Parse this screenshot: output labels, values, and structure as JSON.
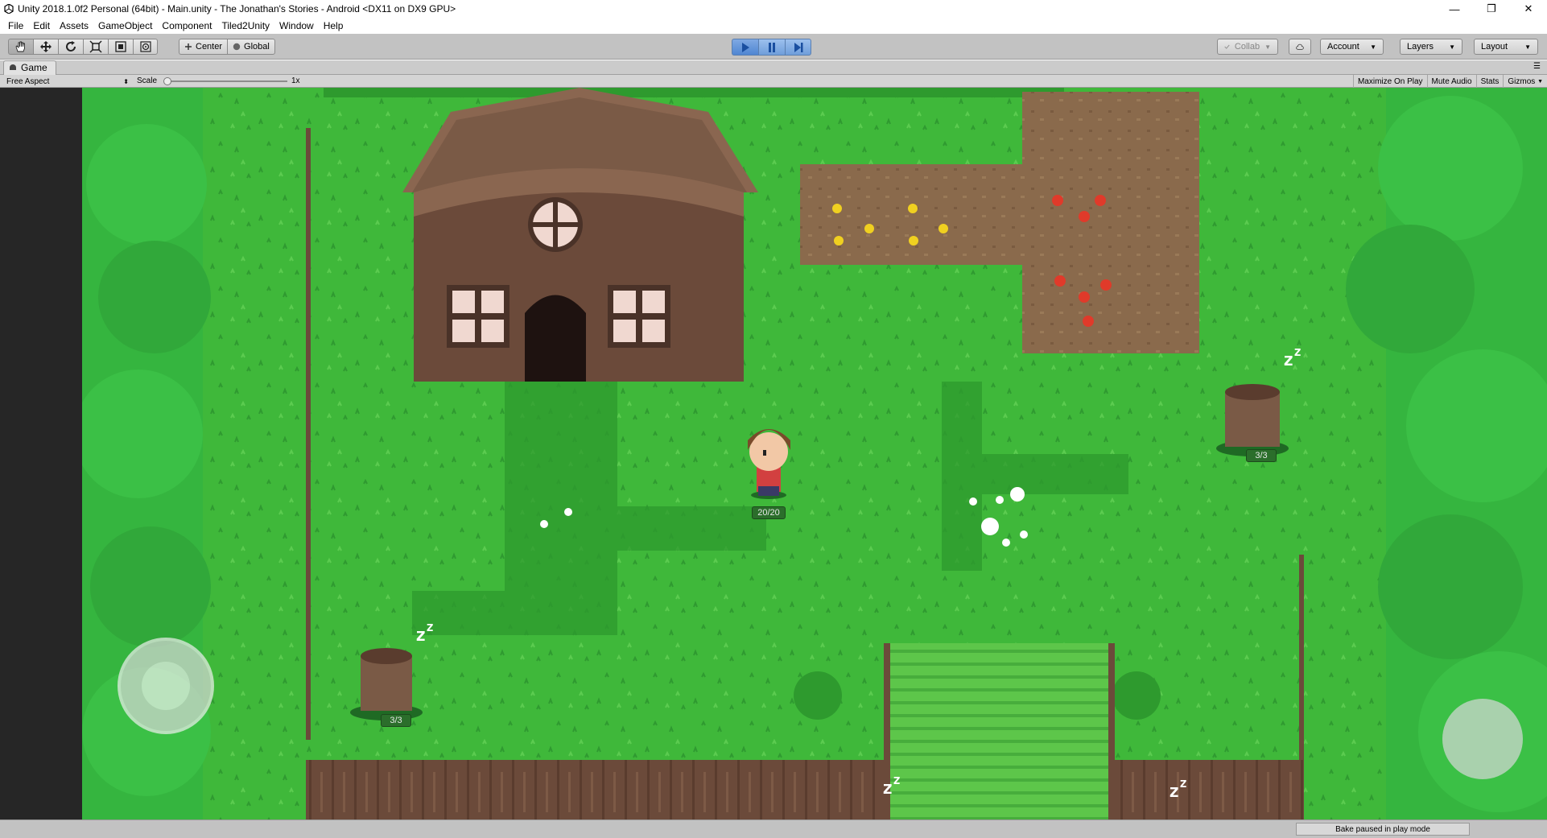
{
  "window": {
    "title": "Unity 2018.1.0f2 Personal (64bit) - Main.unity - The Jonathan's Stories - Android <DX11 on DX9 GPU>",
    "minimize_glyph": "—",
    "maximize_glyph": "❐",
    "close_glyph": "✕"
  },
  "menu": [
    "File",
    "Edit",
    "Assets",
    "GameObject",
    "Component",
    "Tiled2Unity",
    "Window",
    "Help"
  ],
  "toolbar": {
    "tools": [
      "hand-icon",
      "move-icon",
      "rotate-icon",
      "scale-icon",
      "rect-icon",
      "transform-icon"
    ],
    "pivot_label": "Center",
    "rotation_label": "Global",
    "collab_label": "Collab",
    "account_label": "Account",
    "layers_label": "Layers",
    "layout_label": "Layout"
  },
  "game_tab": {
    "label": "Game",
    "aspect": "Free Aspect",
    "scale_label": "Scale",
    "scale_value": "1x",
    "scale_fraction": 0,
    "maximize_label": "Maximize On Play",
    "mute_label": "Mute Audio",
    "stats_label": "Stats",
    "gizmos_label": "Gizmos"
  },
  "game": {
    "player_hp": "20/20",
    "stump_left_hp": "3/3",
    "stump_right_hp": "3/3",
    "sleep_glyph": "z"
  },
  "status": {
    "bake_text": "Bake paused in play mode"
  },
  "colors": {
    "grass": "#3fb83a",
    "grass_dark": "#2e9a2e",
    "trees": "#35b53f",
    "house": "#6b4a3a",
    "soil": "#8a6a4c",
    "play_blue": "#4f86d2"
  }
}
